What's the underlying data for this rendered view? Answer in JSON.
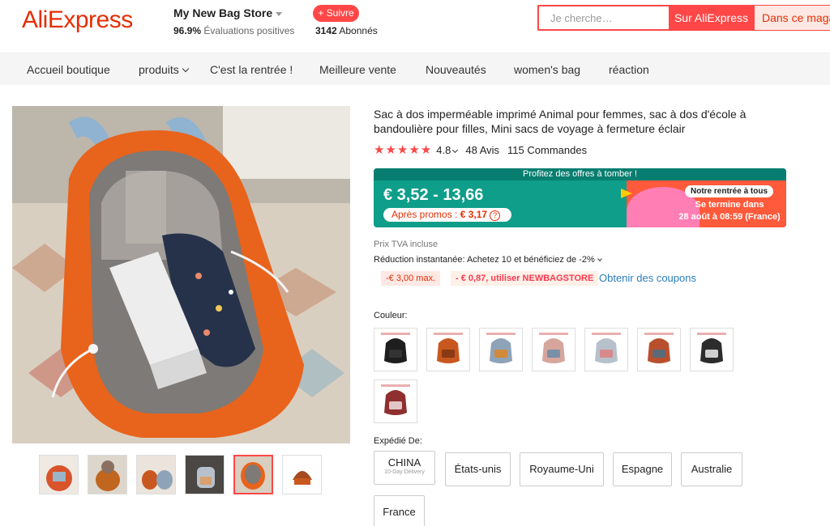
{
  "header": {
    "logo": "AliExpress",
    "store_name": "My New Bag Store",
    "rating_value": "96.9%",
    "rating_label": "Évaluations positives",
    "follow_label": "+ Suivre",
    "followers_count": "3142",
    "followers_label": "Abonnés",
    "search_placeholder": "Je cherche…",
    "search_ali_label": "Sur AliExpress",
    "search_store_label": "Dans ce magasin"
  },
  "nav": {
    "items": [
      {
        "label": "Accueil boutique"
      },
      {
        "label": "produits"
      },
      {
        "label": "C'est la rentrée !"
      },
      {
        "label": "Meilleure vente"
      },
      {
        "label": "Nouveautés"
      },
      {
        "label": "women's bag"
      },
      {
        "label": "réaction"
      }
    ]
  },
  "gallery": {
    "thumbnails": [
      {
        "color": "#d9542a",
        "active": false
      },
      {
        "color": "#c0661f",
        "active": false
      },
      {
        "color": "#b08a70",
        "active": false
      },
      {
        "color": "#6e6a66",
        "active": false
      },
      {
        "color": "#e8631c",
        "active": true
      },
      {
        "color": "#a34a1e",
        "active": false
      }
    ]
  },
  "product": {
    "title": "Sac à dos imperméable imprimé Animal pour femmes, sac à dos d'école à bandoulière pour filles, Mini sacs de voyage à fermeture éclair",
    "rating": "4.8",
    "reviews": "48 Avis",
    "orders": "115 Commandes",
    "promo": {
      "banner_top": "Profitez des offres à tomber !",
      "price_range": "€ 3,52 - 13,66",
      "after_promo_label": "Après promos :",
      "after_promo_price": "€ 3,17",
      "help_icon": "?",
      "tag": "Notre rentrée à tous",
      "ends_line1": "Se termine dans",
      "ends_line2": "28 août à 08:59 (France)"
    },
    "vat": "Prix TVA incluse",
    "reduction": "Réduction instantanée: Achetez 10 et bénéficiez de -2%",
    "coupon1": "-€ 3,00 max.",
    "coupon2": "- € 0,87, utiliser NEWBAGSTORE",
    "get_coupons": "Obtenir des coupons",
    "color_label": "Couleur:",
    "colors": [
      {
        "body": "#1e1e1e",
        "accent": "#333333"
      },
      {
        "body": "#c8581f",
        "accent": "#8a3a14"
      },
      {
        "body": "#8fa3b8",
        "accent": "#d08a3a"
      },
      {
        "body": "#d6a69c",
        "accent": "#7a8fa8"
      },
      {
        "body": "#b7c1cc",
        "accent": "#d88a8a"
      },
      {
        "body": "#b9502d",
        "accent": "#5a6a78"
      },
      {
        "body": "#2c2c2c",
        "accent": "#cfcfcf"
      },
      {
        "body": "#8f2f2f",
        "accent": "#e2c6c6"
      }
    ],
    "ship_label": "Expédié De:",
    "ship_options": [
      {
        "label": "CHINA",
        "sub": "10-Day Delivery"
      },
      {
        "label": "États-unis"
      },
      {
        "label": "Royaume-Uni"
      },
      {
        "label": "Espagne"
      },
      {
        "label": "Australie"
      },
      {
        "label": "France"
      }
    ]
  }
}
